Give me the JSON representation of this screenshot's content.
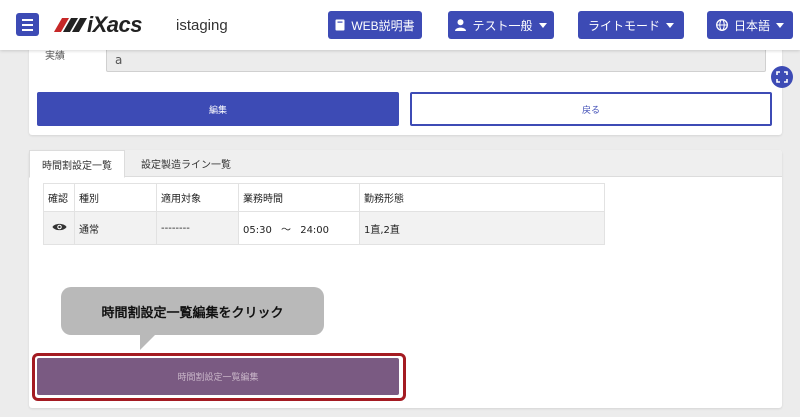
{
  "header": {
    "logo_text": "iXacs",
    "env_name": "istaging",
    "web_manual_label": "WEB説明書",
    "user_label": "テスト一般",
    "theme_label": "ライトモード",
    "language_label": "日本語"
  },
  "form": {
    "field_label": "実績",
    "field_value": "a",
    "edit_label": "編集",
    "back_label": "戻る"
  },
  "tabs": [
    {
      "label": "時間割設定一覧"
    },
    {
      "label": "設定製造ライン一覧"
    }
  ],
  "table": {
    "headers": [
      "確認",
      "種別",
      "適用対象",
      "業務時間",
      "勤務形態"
    ],
    "rows": [
      {
        "type": "通常",
        "target": "--------",
        "start": "05:30",
        "sep": "〜",
        "end": "24:00",
        "shift": "1直,2直"
      }
    ]
  },
  "callout_text": "時間割設定一覧編集をクリック",
  "schedule_edit_label": "時間割設定一覧編集",
  "colors": {
    "primary": "#3d4bb5",
    "highlight": "#a41b22",
    "button_highlighted": "#7a5a82"
  },
  "icons": [
    "menu-icon",
    "book-icon",
    "user-icon",
    "globe-icon",
    "fullscreen-icon",
    "eye-icon"
  ]
}
